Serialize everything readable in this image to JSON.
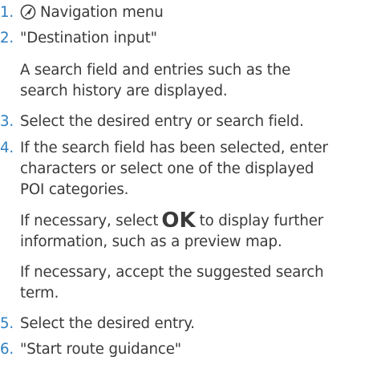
{
  "steps": [
    {
      "number": "1.",
      "icon": "navigation-icon",
      "label": "Navigation menu"
    },
    {
      "number": "2.",
      "label": "\"Destination input\"",
      "note_lines": [
        "A search field and entries such as the",
        "search history are displayed."
      ]
    },
    {
      "number": "3.",
      "label": "Select the desired entry or search field."
    },
    {
      "number": "4.",
      "lines": [
        "If the search field has been selected, enter",
        "characters or select one of the displayed",
        "POI categories."
      ],
      "ok_note": {
        "before": "If necessary, select",
        "ok_label": "OK",
        "after": "to display further",
        "line2": "information, such as a preview map."
      },
      "accept_note_lines": [
        "If necessary, accept the suggested search",
        "term."
      ]
    },
    {
      "number": "5.",
      "label": "Select the desired entry."
    },
    {
      "number": "6.",
      "label": "\"Start route guidance\""
    }
  ],
  "colors": {
    "number": "#2e7fc1",
    "text": "#3a3a3a"
  }
}
